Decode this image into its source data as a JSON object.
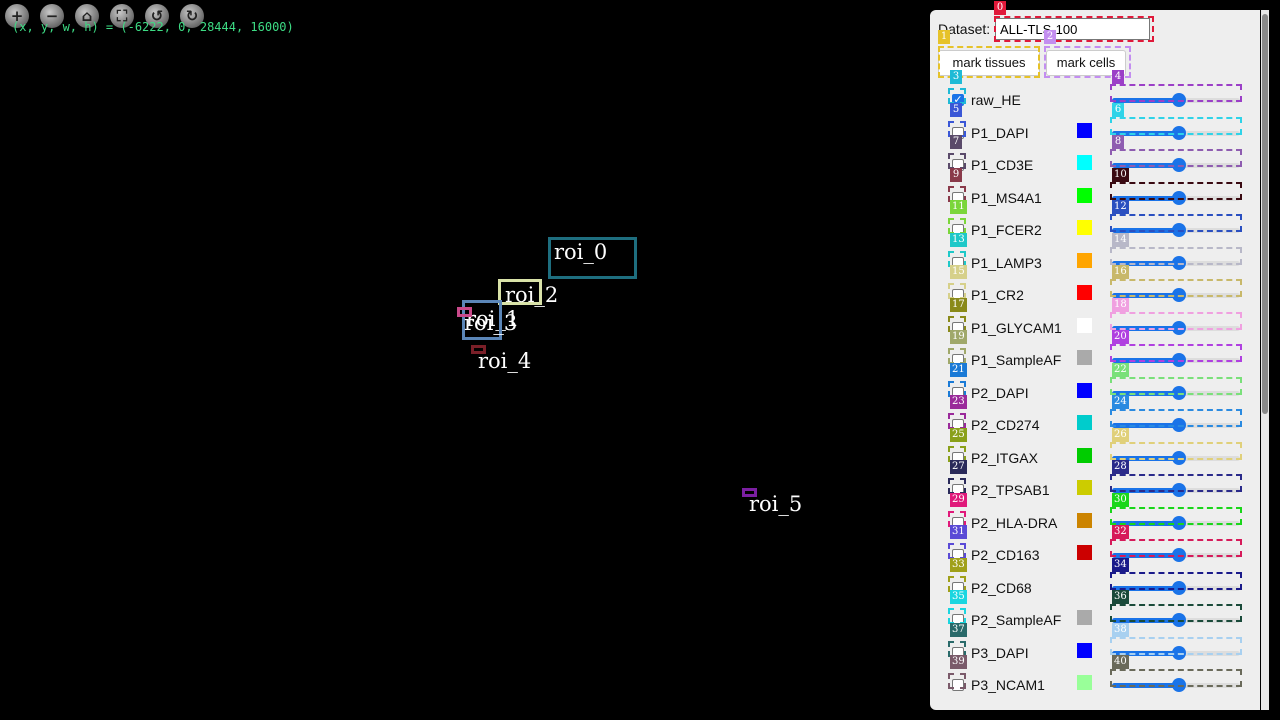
{
  "viewer": {
    "coords_text": "(x, y, w, h) = (-6222, 0, 28444, 16000)",
    "nav_buttons": [
      {
        "name": "zoom-in-icon",
        "glyph": "+"
      },
      {
        "name": "zoom-out-icon",
        "glyph": "−"
      },
      {
        "name": "home-icon",
        "glyph": "⌂"
      },
      {
        "name": "fullscreen-icon",
        "glyph": "⛶"
      },
      {
        "name": "rotate-left-icon",
        "glyph": "↺"
      },
      {
        "name": "rotate-right-icon",
        "glyph": "↻"
      }
    ],
    "rois": [
      {
        "label": "roi_0",
        "color": "#1e6e7f"
      },
      {
        "label": "roi_1",
        "color": "#d9e2a8"
      },
      {
        "label": "roi_2",
        "color": "#d9e2a8"
      },
      {
        "label": "roi_3",
        "color": "#5b86b8"
      },
      {
        "label": "roi_4",
        "color": "#7a1f28"
      },
      {
        "label": "roi_5",
        "color": "#7b1fa2"
      }
    ]
  },
  "panel": {
    "dataset_label": "Dataset:",
    "dataset_value": "ALL-TLS-100",
    "mark_tissues_label": "mark tissues",
    "mark_cells_label": "mark cells",
    "channels": [
      {
        "name": "raw_HE",
        "checked": true,
        "color": null,
        "level": 0.52
      },
      {
        "name": "P1_DAPI",
        "checked": false,
        "color": "#0000ff",
        "level": 0.52
      },
      {
        "name": "P1_CD3E",
        "checked": false,
        "color": "#00ffff",
        "level": 0.52
      },
      {
        "name": "P1_MS4A1",
        "checked": false,
        "color": "#00ff00",
        "level": 0.52
      },
      {
        "name": "P1_FCER2",
        "checked": false,
        "color": "#ffff00",
        "level": 0.52
      },
      {
        "name": "P1_LAMP3",
        "checked": false,
        "color": "#ffa500",
        "level": 0.52
      },
      {
        "name": "P1_CR2",
        "checked": false,
        "color": "#ff0000",
        "level": 0.52
      },
      {
        "name": "P1_GLYCAM1",
        "checked": false,
        "color": "#ffffff",
        "level": 0.52
      },
      {
        "name": "P1_SampleAF",
        "checked": false,
        "color": "#aaaaaa",
        "level": 0.52
      },
      {
        "name": "P2_DAPI",
        "checked": false,
        "color": "#0000ff",
        "level": 0.52
      },
      {
        "name": "P2_CD274",
        "checked": false,
        "color": "#00cccc",
        "level": 0.52
      },
      {
        "name": "P2_ITGAX",
        "checked": false,
        "color": "#00cc00",
        "level": 0.52
      },
      {
        "name": "P2_TPSAB1",
        "checked": false,
        "color": "#cccc00",
        "level": 0.52
      },
      {
        "name": "P2_HLA-DRA",
        "checked": false,
        "color": "#cc8400",
        "level": 0.52
      },
      {
        "name": "P2_CD163",
        "checked": false,
        "color": "#cc0000",
        "level": 0.52
      },
      {
        "name": "P2_CD68",
        "checked": false,
        "color": "#eeeeee",
        "level": 0.52
      },
      {
        "name": "P2_SampleAF",
        "checked": false,
        "color": "#aaaaaa",
        "level": 0.52
      },
      {
        "name": "P3_DAPI",
        "checked": false,
        "color": "#0000ff",
        "level": 0.52
      },
      {
        "name": "P3_NCAM1",
        "checked": false,
        "color": "#99ff99",
        "level": 0.52
      }
    ]
  },
  "markers": [
    {
      "id": "0",
      "color": "#e0193a"
    },
    {
      "id": "1",
      "color": "#e6c229"
    },
    {
      "id": "2",
      "color": "#c38ef0"
    },
    {
      "id": "3",
      "color": "#1fbad6"
    },
    {
      "id": "4",
      "color": "#9b3fc7"
    },
    {
      "id": "5",
      "color": "#3a57d6"
    },
    {
      "id": "6",
      "color": "#2fd3e8"
    },
    {
      "id": "7",
      "color": "#5a4a6a"
    },
    {
      "id": "8",
      "color": "#8e5cb0"
    },
    {
      "id": "9",
      "color": "#8a3a4a"
    },
    {
      "id": "10",
      "color": "#3a0a12"
    },
    {
      "id": "11",
      "color": "#7bd63a"
    },
    {
      "id": "12",
      "color": "#2a4fc0"
    },
    {
      "id": "13",
      "color": "#1ec8c8"
    },
    {
      "id": "14",
      "color": "#b8b8c8"
    },
    {
      "id": "15",
      "color": "#d6d08a"
    },
    {
      "id": "16",
      "color": "#c8b86a"
    },
    {
      "id": "17",
      "color": "#8a8a1a"
    },
    {
      "id": "18",
      "color": "#f0a0e0"
    },
    {
      "id": "19",
      "color": "#a0a86a"
    },
    {
      "id": "20",
      "color": "#b040e0"
    },
    {
      "id": "21",
      "color": "#1a7ad6"
    },
    {
      "id": "22",
      "color": "#7ae07a"
    },
    {
      "id": "23",
      "color": "#9a2a9a"
    },
    {
      "id": "24",
      "color": "#2a8ae0"
    },
    {
      "id": "25",
      "color": "#8aa01a"
    },
    {
      "id": "26",
      "color": "#e0d07a"
    },
    {
      "id": "27",
      "color": "#2a2a5a"
    },
    {
      "id": "28",
      "color": "#2a2a8a"
    },
    {
      "id": "29",
      "color": "#e0197a"
    },
    {
      "id": "30",
      "color": "#1ad61a"
    },
    {
      "id": "31",
      "color": "#5a4ad6"
    },
    {
      "id": "32",
      "color": "#d61a5a"
    },
    {
      "id": "33",
      "color": "#a0a01a"
    },
    {
      "id": "34",
      "color": "#1a1a8a"
    },
    {
      "id": "35",
      "color": "#1ad6e0"
    },
    {
      "id": "36",
      "color": "#1a4a3a"
    },
    {
      "id": "37",
      "color": "#2a6a6a"
    },
    {
      "id": "38",
      "color": "#a8d0f0"
    },
    {
      "id": "39",
      "color": "#7a5a6a"
    },
    {
      "id": "40",
      "color": "#6a6a5a"
    }
  ]
}
